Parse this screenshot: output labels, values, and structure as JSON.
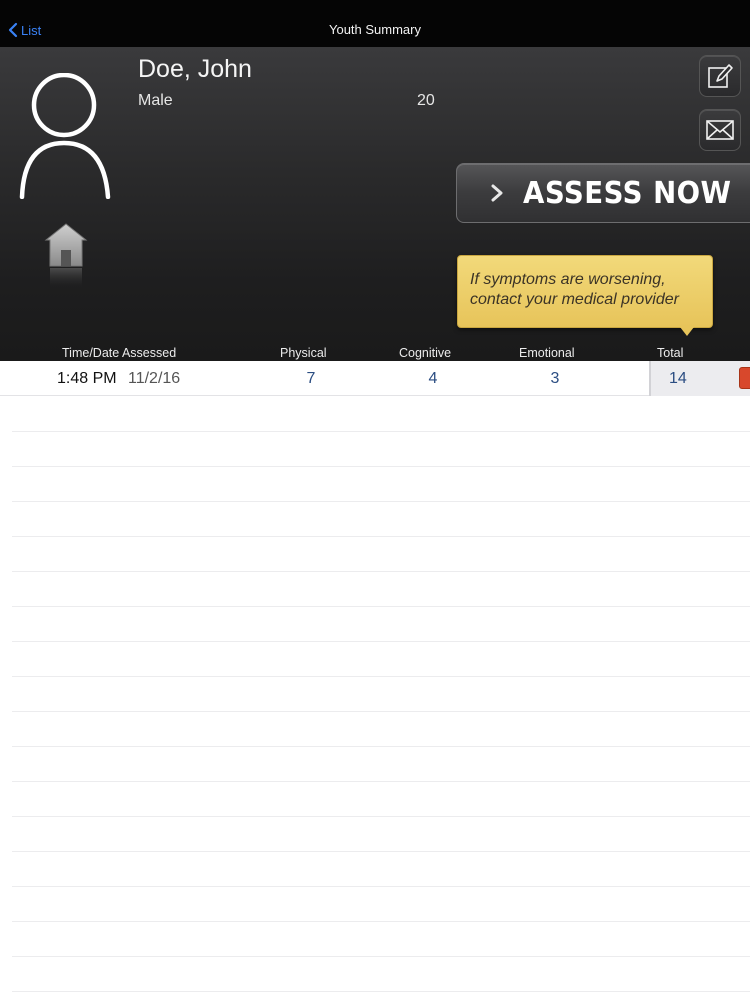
{
  "nav": {
    "back_label": "List",
    "title": "Youth Summary"
  },
  "youth": {
    "name": "Doe, John",
    "gender": "Male",
    "age": "20"
  },
  "actions": {
    "assess_label": "ASSESS NOW"
  },
  "tooltip": {
    "text": "If symptoms are worsening, contact your medical provider"
  },
  "columns": {
    "time_date": "Time/Date Assessed",
    "physical": "Physical",
    "cognitive": "Cognitive",
    "emotional": "Emotional",
    "total": "Total"
  },
  "assessments": [
    {
      "time": "1:48 PM",
      "date": "11/2/16",
      "physical": "7",
      "cognitive": "4",
      "emotional": "3",
      "total": "14"
    }
  ],
  "colors": {
    "back_blue": "#3a82f6",
    "value_blue": "#2b4d82",
    "tooltip_gold": "#e7c45a",
    "status_red": "#d8482c"
  }
}
